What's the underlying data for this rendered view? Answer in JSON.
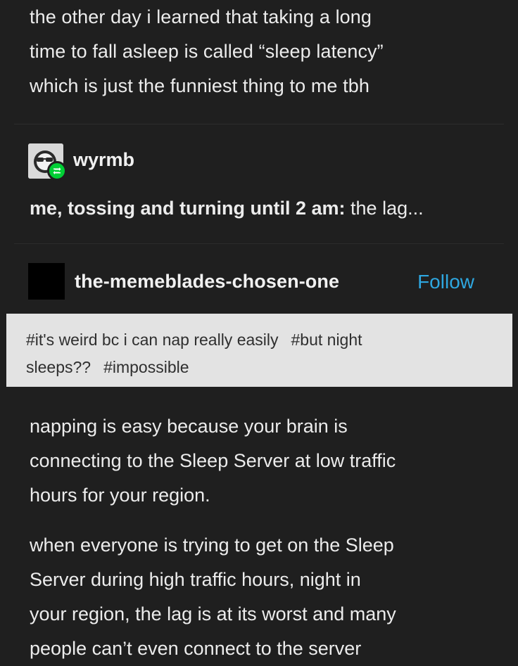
{
  "original_post": {
    "lines": [
      "the other day i learned that taking a long",
      "time to fall asleep is called “sleep latency”",
      "which is just the funniest thing to me tbh"
    ]
  },
  "reblog": {
    "username": "wyrmb",
    "text_bold": "me, tossing and turning until 2 am:",
    "text_rest": " the lag..."
  },
  "blog": {
    "name": "the-memeblades-chosen-one",
    "follow_label": "Follow",
    "follow_color": "#2ea7e0"
  },
  "tags": {
    "line1": [
      "#it's weird bc i can nap really easily",
      "#but night"
    ],
    "line2": [
      "sleeps??",
      "#impossible"
    ]
  },
  "body": {
    "paragraph1": [
      "napping is easy because your brain is",
      "connecting to the Sleep Server at low traffic",
      "hours for your region."
    ],
    "paragraph2": [
      "when everyone is trying to get on the Sleep",
      "Server during high traffic hours, night in",
      "your region, the lag is at its worst and many",
      "people can’t even connect to the server"
    ]
  },
  "icons": {
    "reblog_badge": "reblog-icon",
    "avatar": "sunglasses-face-icon"
  },
  "colors": {
    "background": "#1f1f1f",
    "reblog_green": "#00cf35",
    "tags_background": "#e3e3e3"
  }
}
